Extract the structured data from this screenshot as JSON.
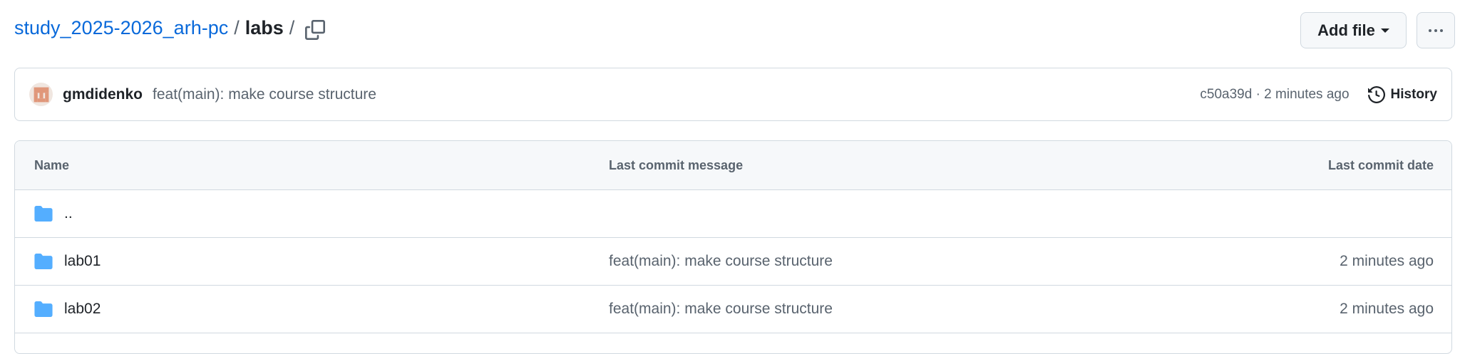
{
  "breadcrumb": {
    "repo": "study_2025-2026_arh-pc",
    "sep": "/",
    "folder": "labs",
    "trailing_sep": "/"
  },
  "toolbar": {
    "add_file_label": "Add file",
    "more_icon": "kebab-horizontal-icon"
  },
  "latest_commit": {
    "author": "gmdidenko",
    "message": "feat(main): make course structure",
    "sha_time": "c50a39d · 2 minutes ago",
    "history_label": "History"
  },
  "table": {
    "headers": {
      "name": "Name",
      "message": "Last commit message",
      "date": "Last commit date"
    },
    "rows": [
      {
        "name": "..",
        "message": "",
        "date": ""
      },
      {
        "name": "lab01",
        "message": "feat(main): make course structure",
        "date": "2 minutes ago"
      },
      {
        "name": "lab02",
        "message": "feat(main): make course structure",
        "date": "2 minutes ago"
      }
    ]
  },
  "colors": {
    "link": "#0969da",
    "folder": "#54aeff",
    "border": "#d1d9e0",
    "header_bg": "#f6f8fa"
  }
}
